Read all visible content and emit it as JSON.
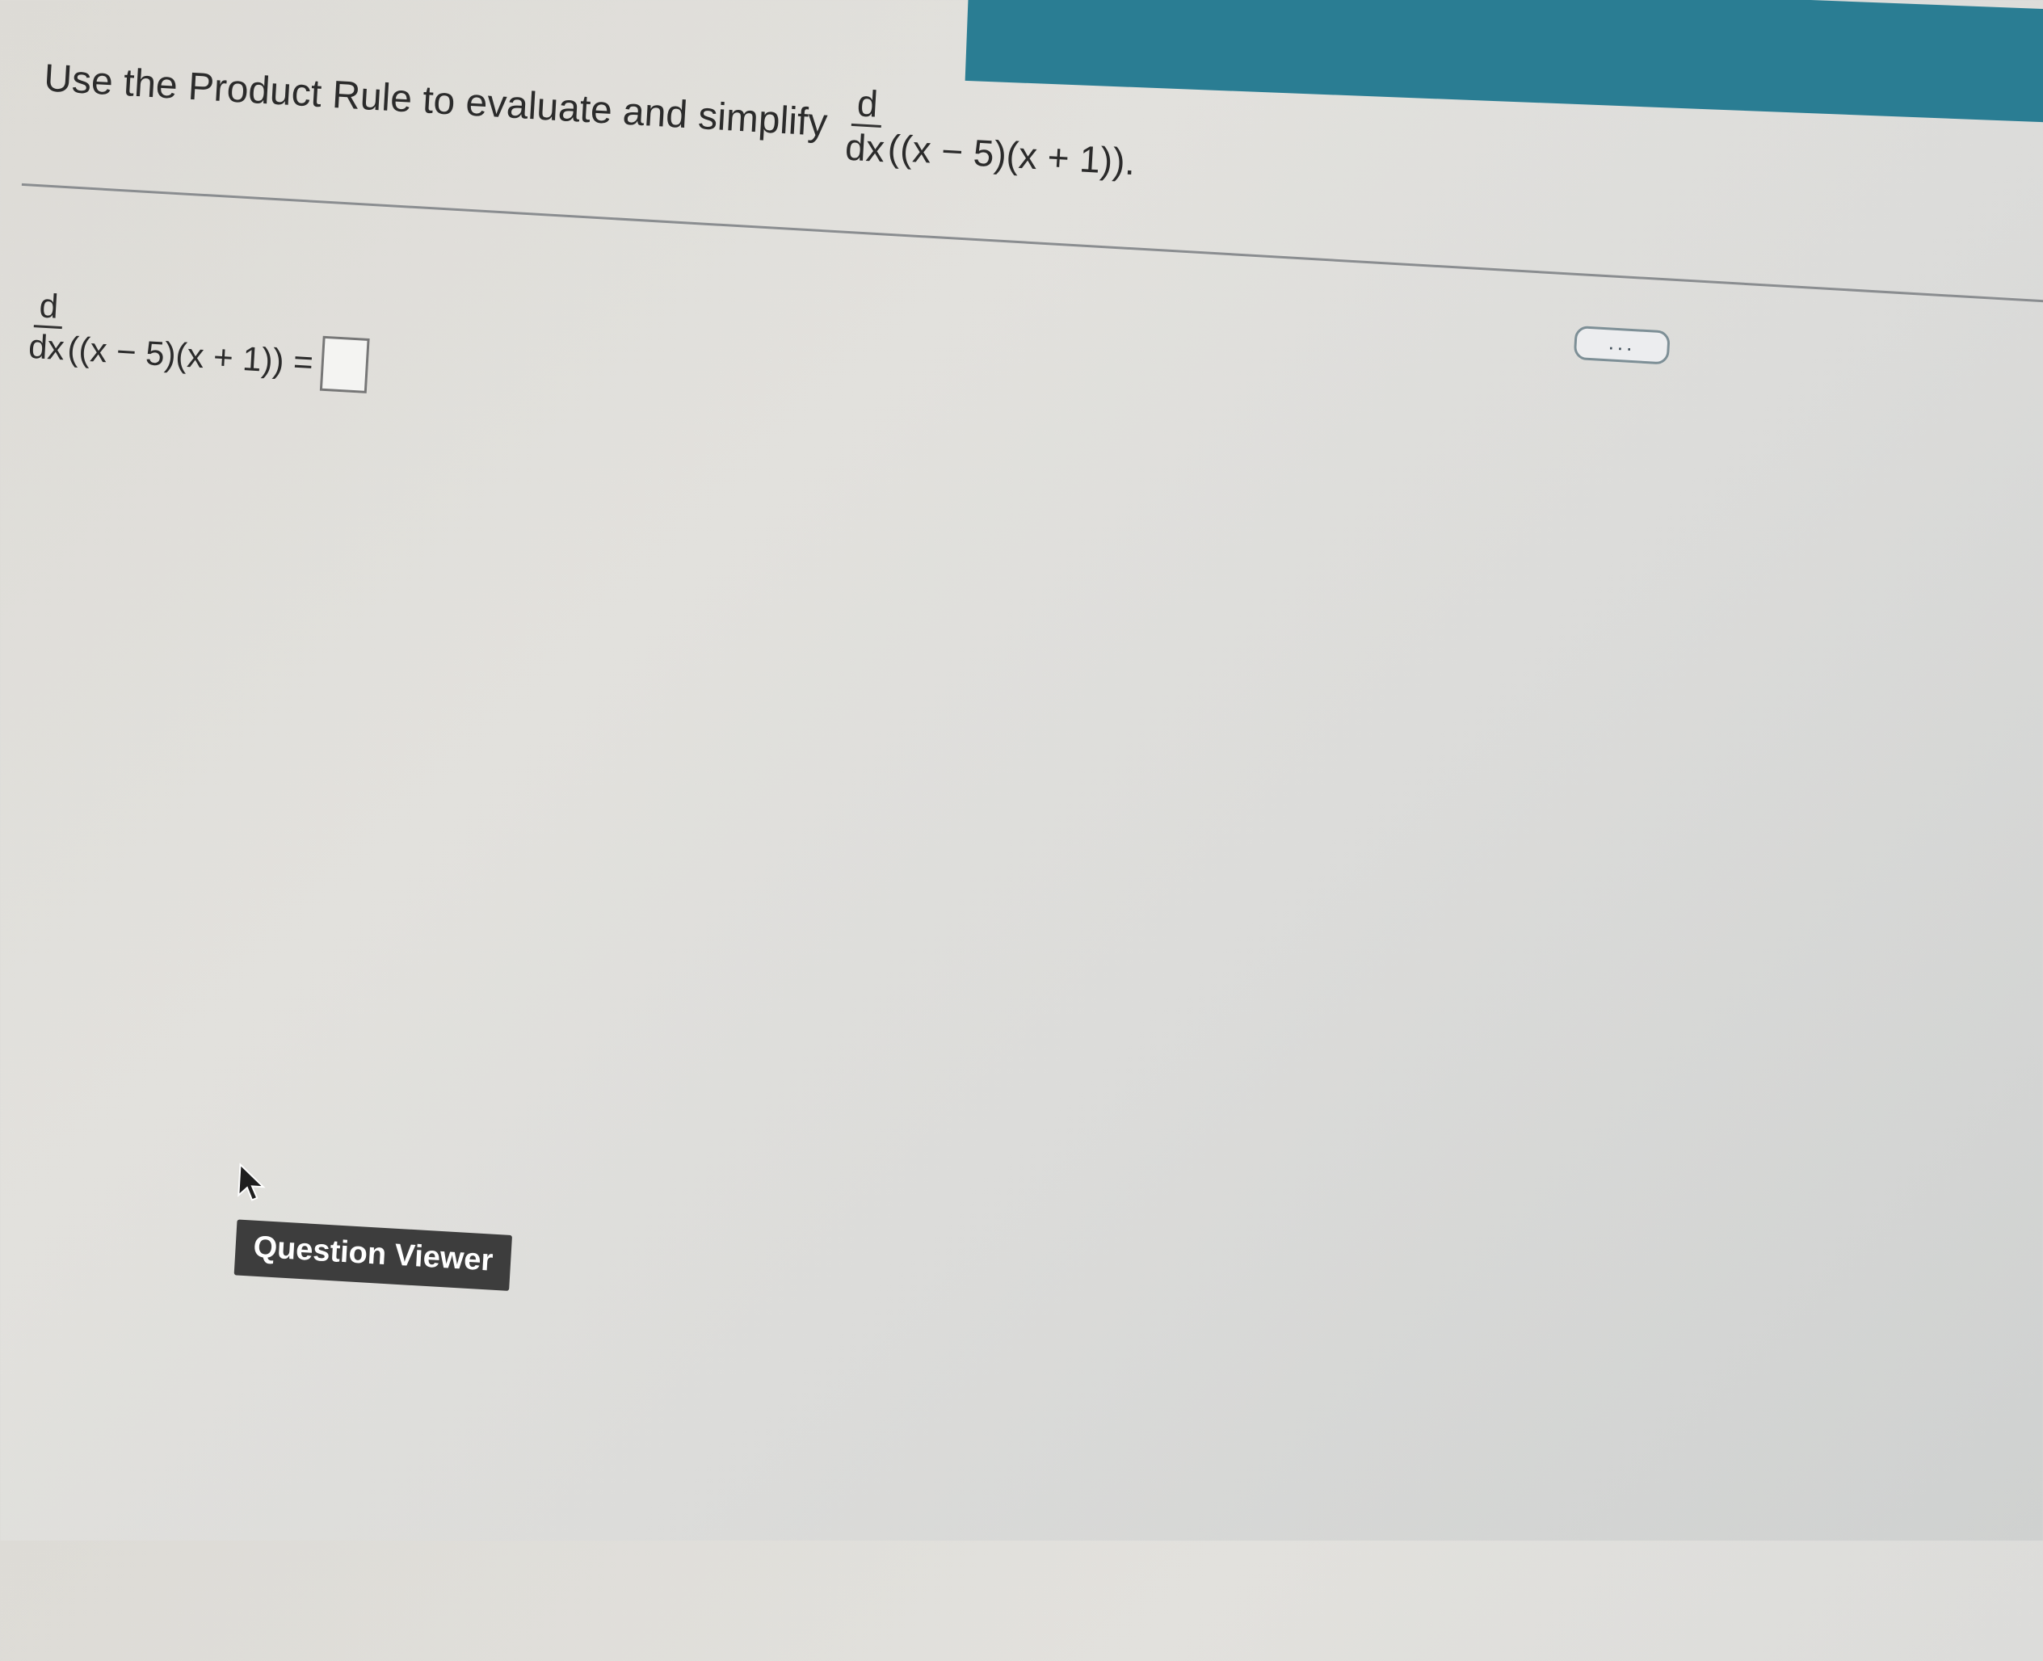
{
  "colors": {
    "header_accent": "#2a7d93",
    "tooltip_background": "#3d3d3d",
    "tooltip_text": "#ffffff"
  },
  "question": {
    "prompt": "Use the Product Rule to evaluate and simplify",
    "derivative_numerator": "d",
    "derivative_denominator": "dx",
    "expression": "((x − 5)(x + 1))."
  },
  "more_button": {
    "label": "...",
    "icon": "ellipsis-icon"
  },
  "answer": {
    "derivative_numerator": "d",
    "derivative_denominator": "dx",
    "expression": "((x − 5)(x + 1)) =",
    "value": ""
  },
  "cursor": {
    "icon": "mouse-pointer-icon"
  },
  "tooltip": {
    "label": "Question Viewer"
  }
}
